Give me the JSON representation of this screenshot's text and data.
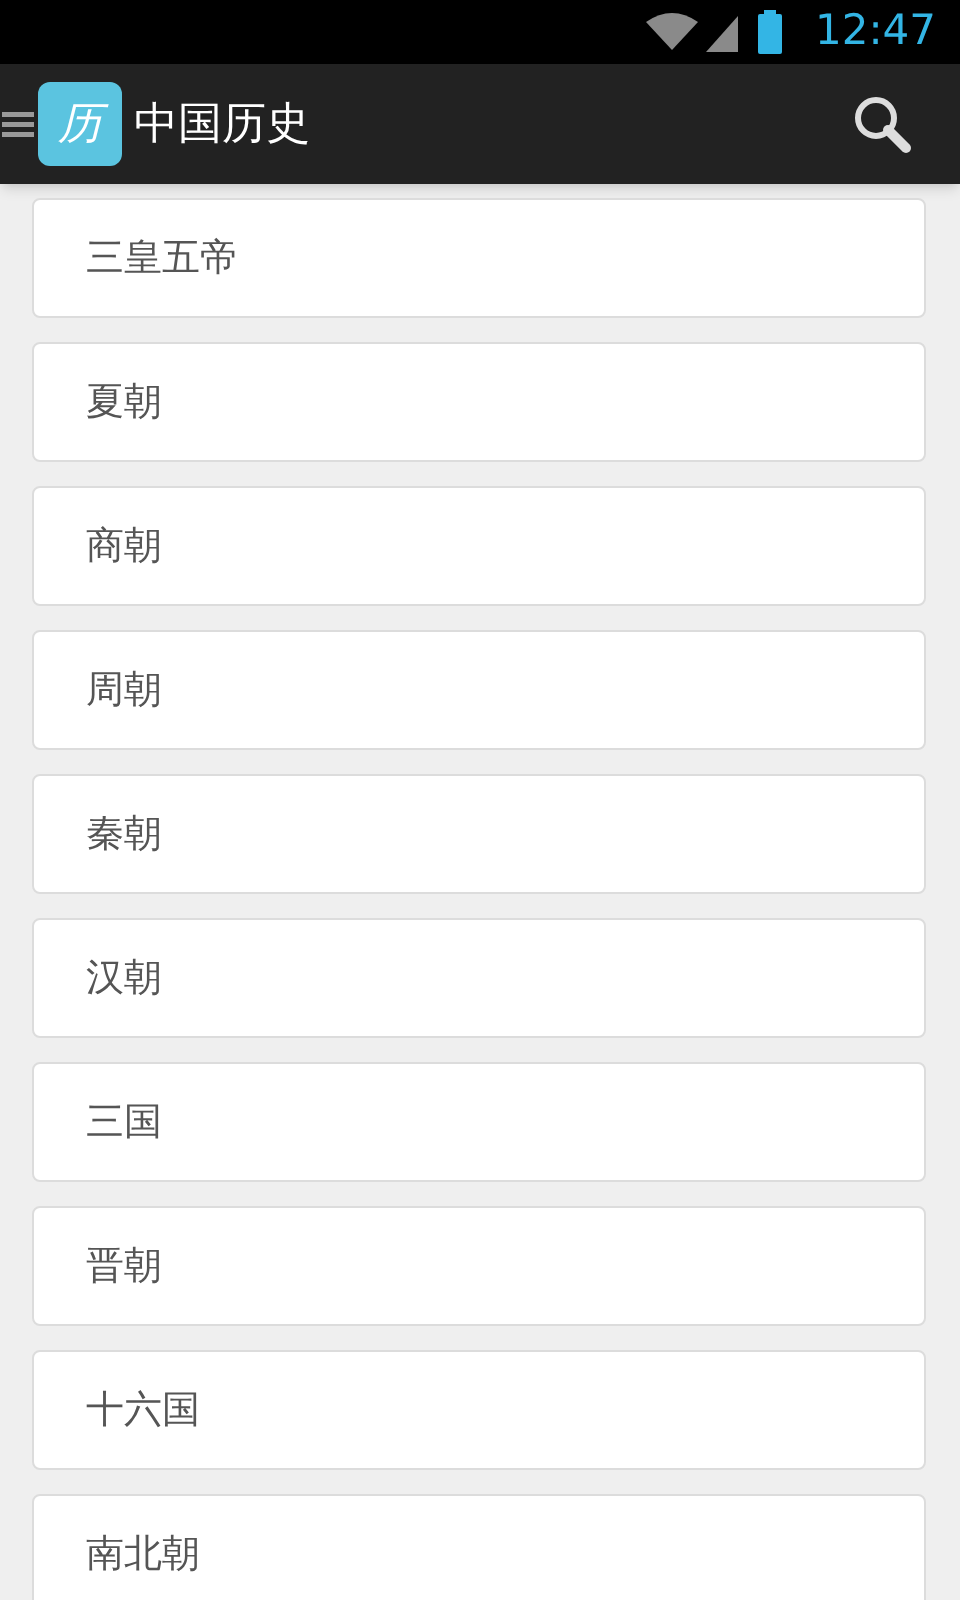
{
  "status_bar": {
    "time": "12:47"
  },
  "app_bar": {
    "logo_text": "历",
    "title": "中国历史"
  },
  "items": [
    {
      "label": "三皇五帝"
    },
    {
      "label": "夏朝"
    },
    {
      "label": "商朝"
    },
    {
      "label": "周朝"
    },
    {
      "label": "秦朝"
    },
    {
      "label": "汉朝"
    },
    {
      "label": "三国"
    },
    {
      "label": "晋朝"
    },
    {
      "label": "十六国"
    },
    {
      "label": "南北朝"
    }
  ]
}
